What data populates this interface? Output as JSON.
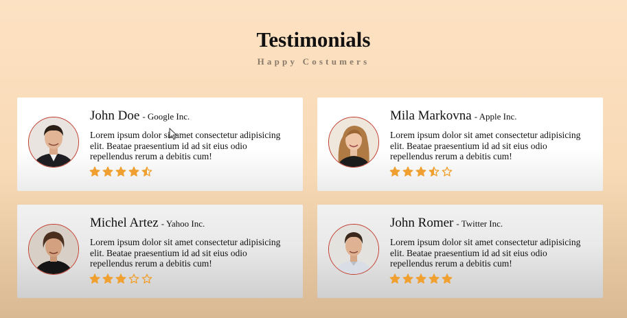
{
  "header": {
    "title": "Testimonials",
    "subtitle": "Happy Costumers"
  },
  "colors": {
    "accent": "#f0a030",
    "avatar_border": "#c0392b"
  },
  "testimonials": [
    {
      "name": "John Doe",
      "company": "- Google Inc.",
      "text": "Lorem ipsum dolor sit amet consectetur adipisicing elit. Beatae praesentium id ad sit eius odio repellendus rerum a debitis cum!",
      "rating": 4.5
    },
    {
      "name": "Mila Markovna",
      "company": "- Apple Inc.",
      "text": "Lorem ipsum dolor sit amet consectetur adipisicing elit. Beatae praesentium id ad sit eius odio repellendus rerum a debitis cum!",
      "rating": 3.5
    },
    {
      "name": "Michel Artez",
      "company": "- Yahoo Inc.",
      "text": "Lorem ipsum dolor sit amet consectetur adipisicing elit. Beatae praesentium id ad sit eius odio repellendus rerum a debitis cum!",
      "rating": 3
    },
    {
      "name": "John Romer",
      "company": "- Twitter Inc.",
      "text": "Lorem ipsum dolor sit amet consectetur adipisicing elit. Beatae praesentium id ad sit eius odio repellendus rerum a debitis cum!",
      "rating": 5
    }
  ]
}
